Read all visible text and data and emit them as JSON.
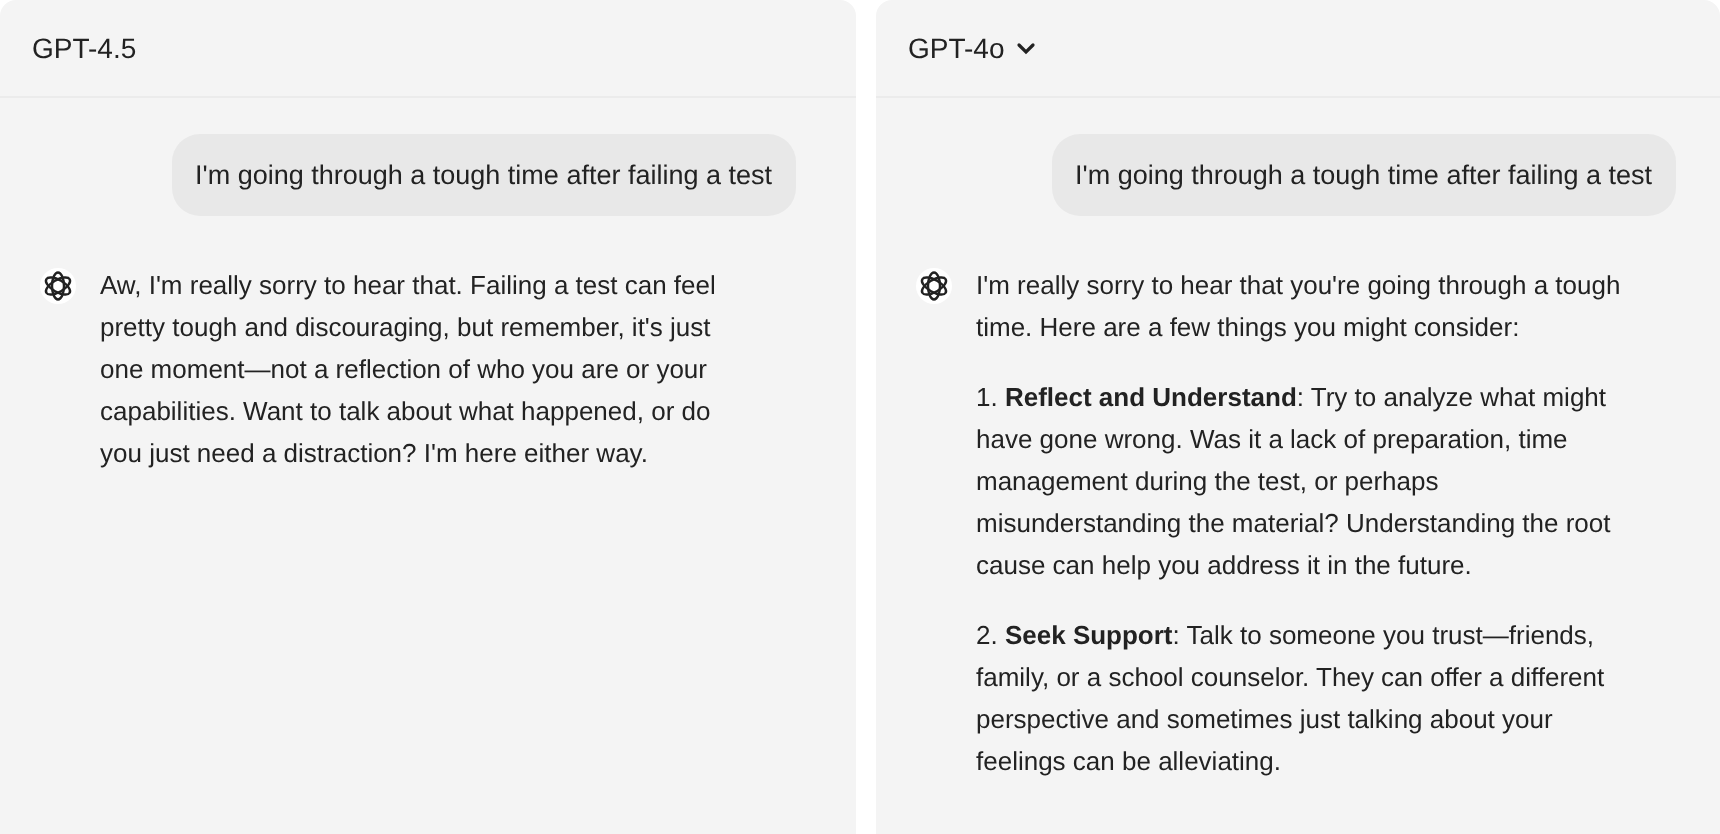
{
  "panels": [
    {
      "model": "GPT-4.5",
      "dropdown": false,
      "user_message": "I'm going through a tough time after failing a test",
      "reply": [
        "Aw, I'm really sorry to hear that. Failing a test can feel pretty tough and discouraging, but remember, it's just one moment—not a reflection of who you are or your capabilities. Want to talk about what happened, or do you just need a distraction? I'm here either way."
      ]
    },
    {
      "model": "GPT-4o",
      "dropdown": true,
      "user_message": "I'm going through a tough time after failing a test",
      "reply": [
        "I'm really sorry to hear that you're going through a tough time. Here are a few things you might consider:",
        "1. **Reflect and Understand**: Try to analyze what might have gone wrong. Was it a lack of preparation, time management during the test, or perhaps misunderstanding the material? Understanding the root cause can help you address it in the future.",
        "2. **Seek Support**: Talk to someone you trust—friends, family, or a school counselor. They can offer a different perspective and sometimes just talking about your feelings can be alleviating."
      ]
    }
  ]
}
